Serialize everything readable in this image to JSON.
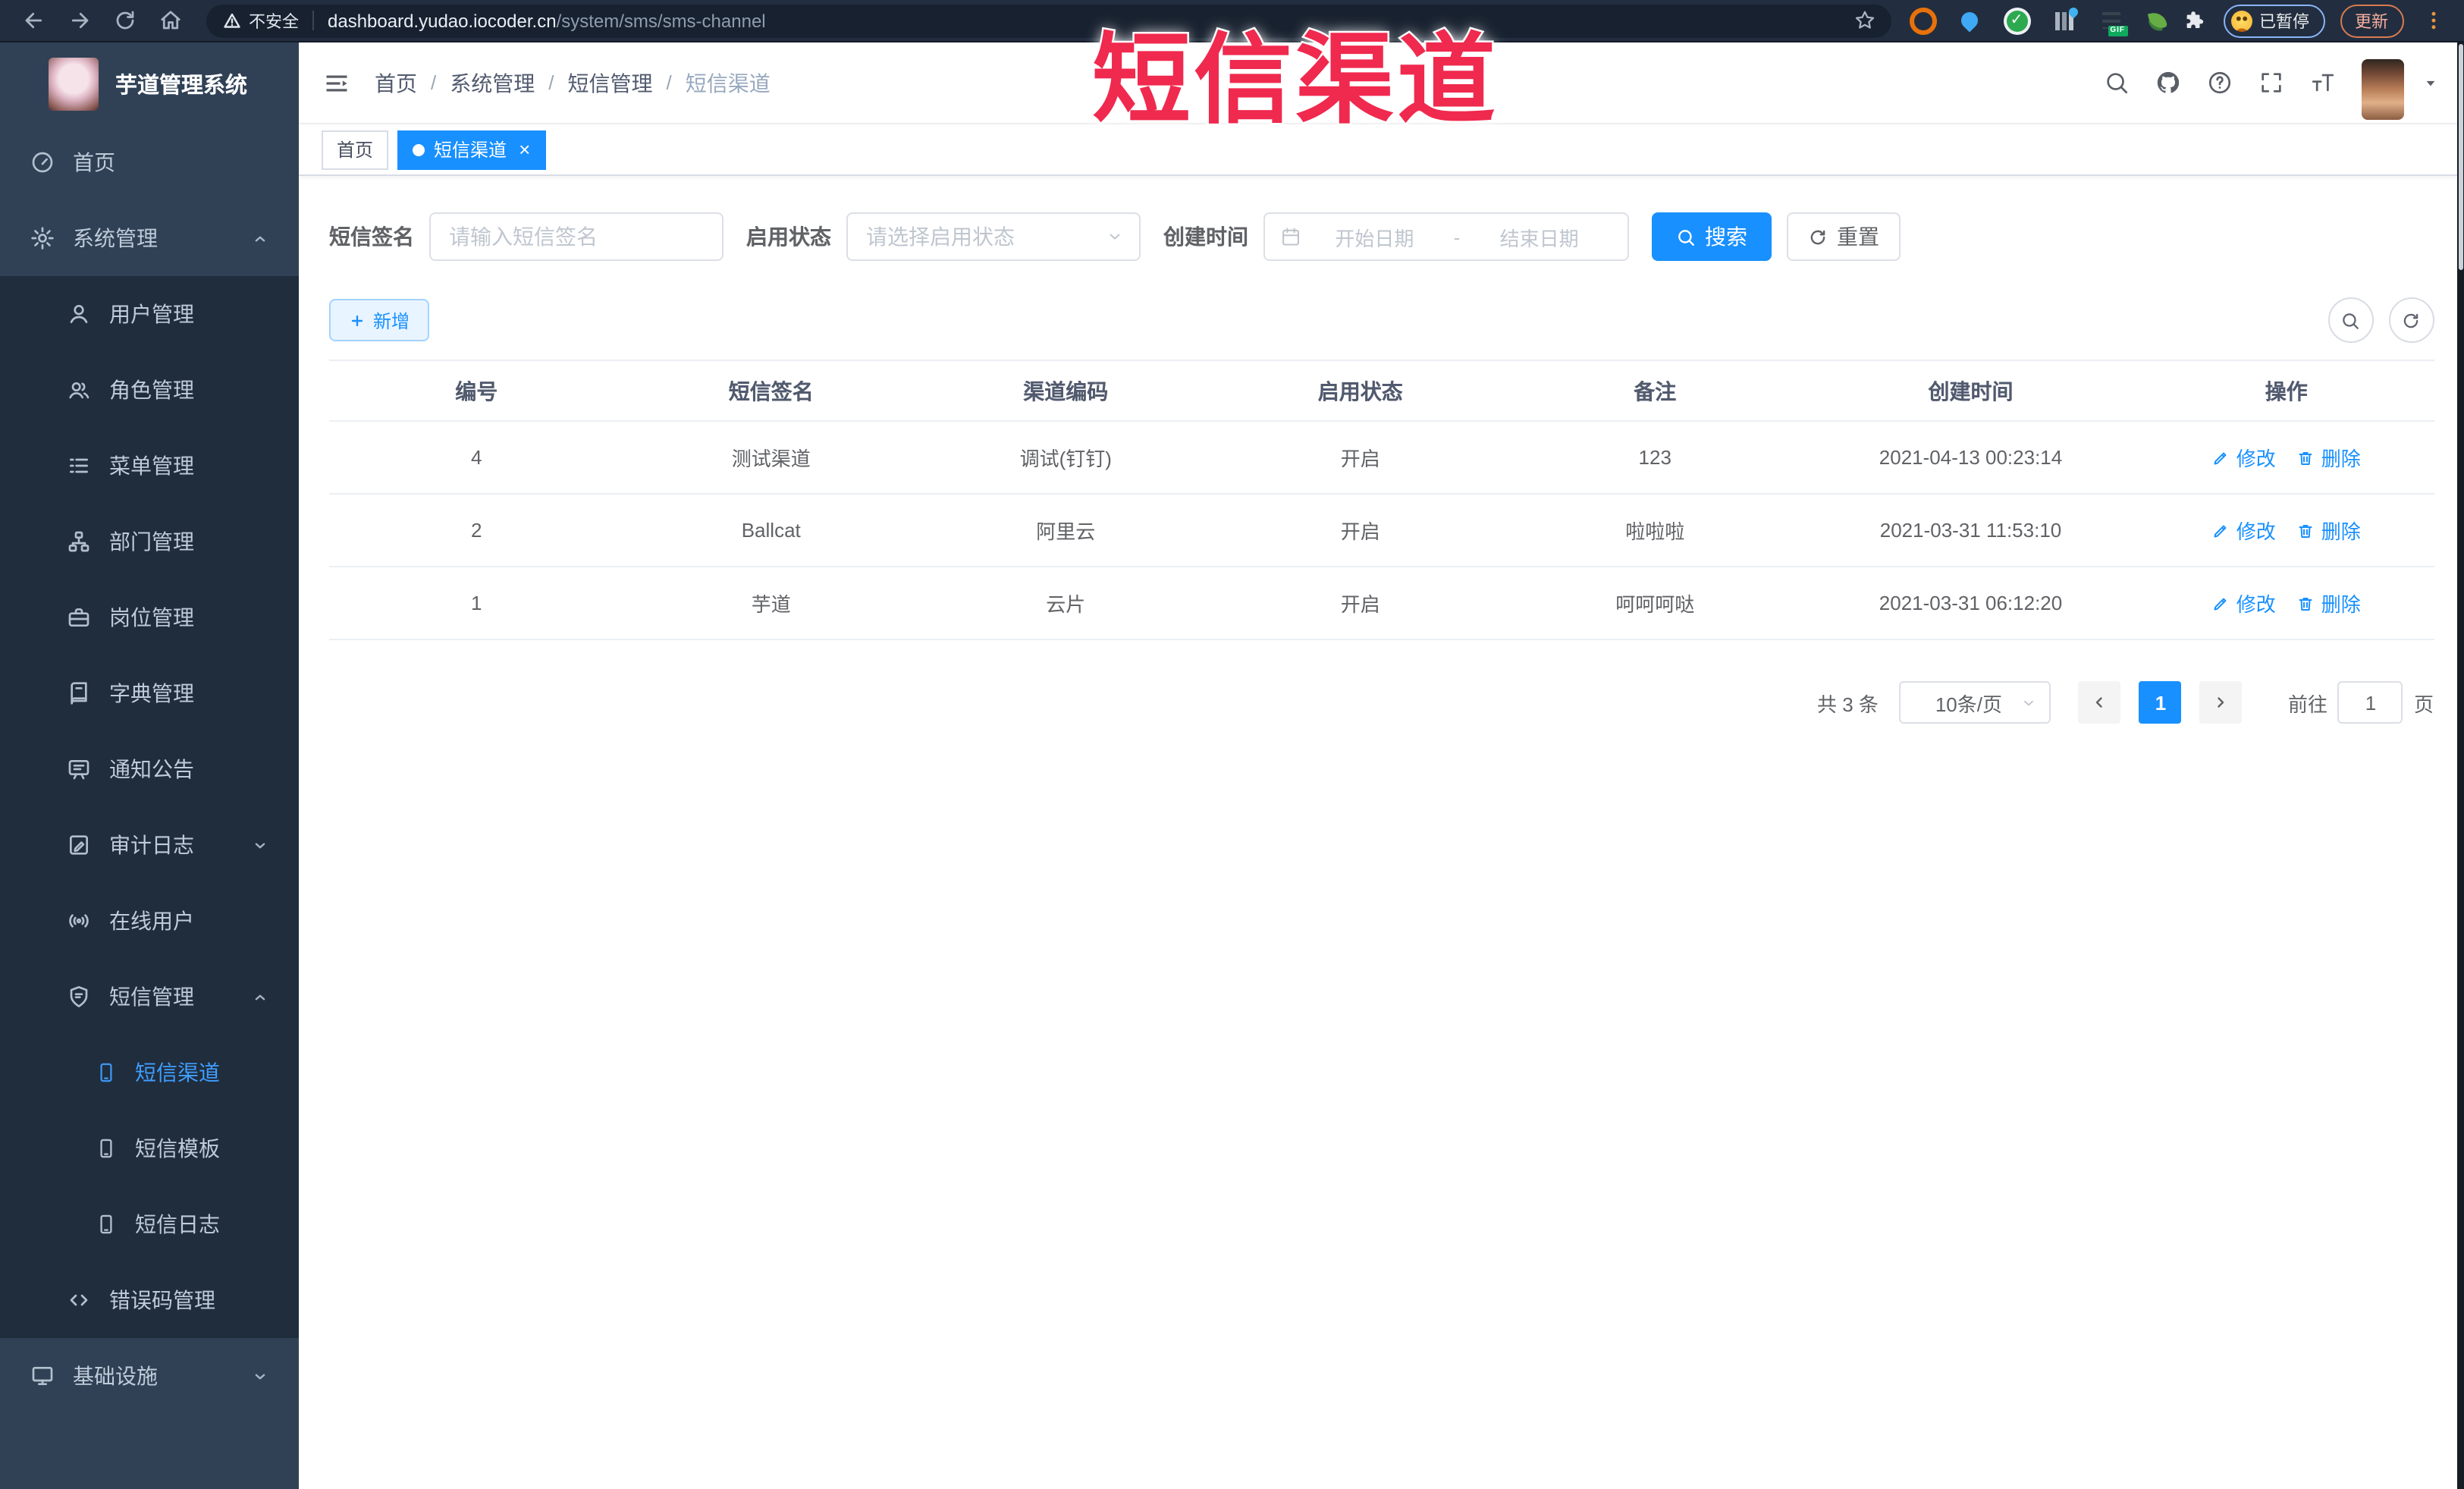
{
  "colors": {
    "primary": "#1890ff",
    "menu_active": "#409eff",
    "sidebar_bg": "#304156",
    "submenu_bg": "#1f2d3d",
    "watermark": "#f0294e",
    "link": "#1890ff"
  },
  "watermark": {
    "text": "短信渠道"
  },
  "browser": {
    "security_label": "不安全",
    "url_host": "dashboard.yudao.iocoder.cn",
    "url_path": "/system/sms/sms-channel",
    "paused_badge": "已暂停",
    "update_button": "更新",
    "extensions": [
      "orange-ring",
      "blue-pin",
      "green-check",
      "equalizer-drop",
      "list-gif",
      "sprout"
    ]
  },
  "sidebar": {
    "logo_title": "芋道管理系统",
    "menu": [
      {
        "key": "home",
        "label": "首页",
        "icon": "dashboard",
        "level": 1
      },
      {
        "key": "system-management",
        "label": "系统管理",
        "icon": "gear",
        "level": 1,
        "chevron": "up"
      },
      {
        "key": "user-management",
        "label": "用户管理",
        "icon": "user",
        "level": 2
      },
      {
        "key": "role-management",
        "label": "角色管理",
        "icon": "role",
        "level": 2
      },
      {
        "key": "menu-management",
        "label": "菜单管理",
        "icon": "menu-list",
        "level": 2
      },
      {
        "key": "dept-management",
        "label": "部门管理",
        "icon": "org-tree",
        "level": 2
      },
      {
        "key": "post-management",
        "label": "岗位管理",
        "icon": "post",
        "level": 2
      },
      {
        "key": "dict-management",
        "label": "字典管理",
        "icon": "dict-book",
        "level": 2
      },
      {
        "key": "notice-announcement",
        "label": "通知公告",
        "icon": "announcement",
        "level": 2
      },
      {
        "key": "audit-log",
        "label": "审计日志",
        "icon": "audit-log",
        "level": 2,
        "chevron": "down"
      },
      {
        "key": "online-users",
        "label": "在线用户",
        "icon": "online-user",
        "level": 2
      },
      {
        "key": "sms-management",
        "label": "短信管理",
        "icon": "sms-shield",
        "level": 2,
        "chevron": "up"
      },
      {
        "key": "sms-channel",
        "label": "短信渠道",
        "icon": "phone",
        "level": 3,
        "active": true
      },
      {
        "key": "sms-template",
        "label": "短信模板",
        "icon": "phone",
        "level": 3
      },
      {
        "key": "sms-log",
        "label": "短信日志",
        "icon": "phone",
        "level": 3
      },
      {
        "key": "error-code-management",
        "label": "错误码管理",
        "icon": "code",
        "level": 2
      },
      {
        "key": "infrastructure",
        "label": "基础设施",
        "icon": "monitor",
        "level": 1,
        "chevron": "down"
      }
    ]
  },
  "header": {
    "breadcrumbs": [
      {
        "label": "首页"
      },
      {
        "label": "系统管理"
      },
      {
        "label": "短信管理"
      },
      {
        "label": "短信渠道",
        "current": true
      }
    ]
  },
  "tabs": [
    {
      "label": "首页",
      "active": false
    },
    {
      "label": "短信渠道",
      "active": true,
      "close": "×"
    }
  ],
  "filters": {
    "sign_label": "短信签名",
    "sign_placeholder": "请输入短信签名",
    "status_label": "启用状态",
    "status_placeholder": "请选择启用状态",
    "time_label": "创建时间",
    "start_placeholder": "开始日期",
    "range_separator": "-",
    "end_placeholder": "结束日期",
    "search_label": "搜索",
    "reset_label": "重置"
  },
  "toolbar": {
    "add_label": "新增"
  },
  "table": {
    "columns": [
      "编号",
      "短信签名",
      "渠道编码",
      "启用状态",
      "备注",
      "创建时间",
      "操作"
    ],
    "rows": [
      {
        "id": "4",
        "sign": "测试渠道",
        "code": "调试(钉钉)",
        "status": "开启",
        "remark": "123",
        "created": "2021-04-13 00:23:14"
      },
      {
        "id": "2",
        "sign": "Ballcat",
        "code": "阿里云",
        "status": "开启",
        "remark": "啦啦啦",
        "created": "2021-03-31 11:53:10"
      },
      {
        "id": "1",
        "sign": "芋道",
        "code": "云片",
        "status": "开启",
        "remark": "呵呵呵哒",
        "created": "2021-03-31 06:12:20"
      }
    ],
    "edit_label": "修改",
    "delete_label": "删除"
  },
  "pagination": {
    "total_label": "共 3 条",
    "page_size_label": "10条/页",
    "current_page": "1",
    "goto_label": "前往",
    "goto_value": "1",
    "page_suffix": "页"
  }
}
